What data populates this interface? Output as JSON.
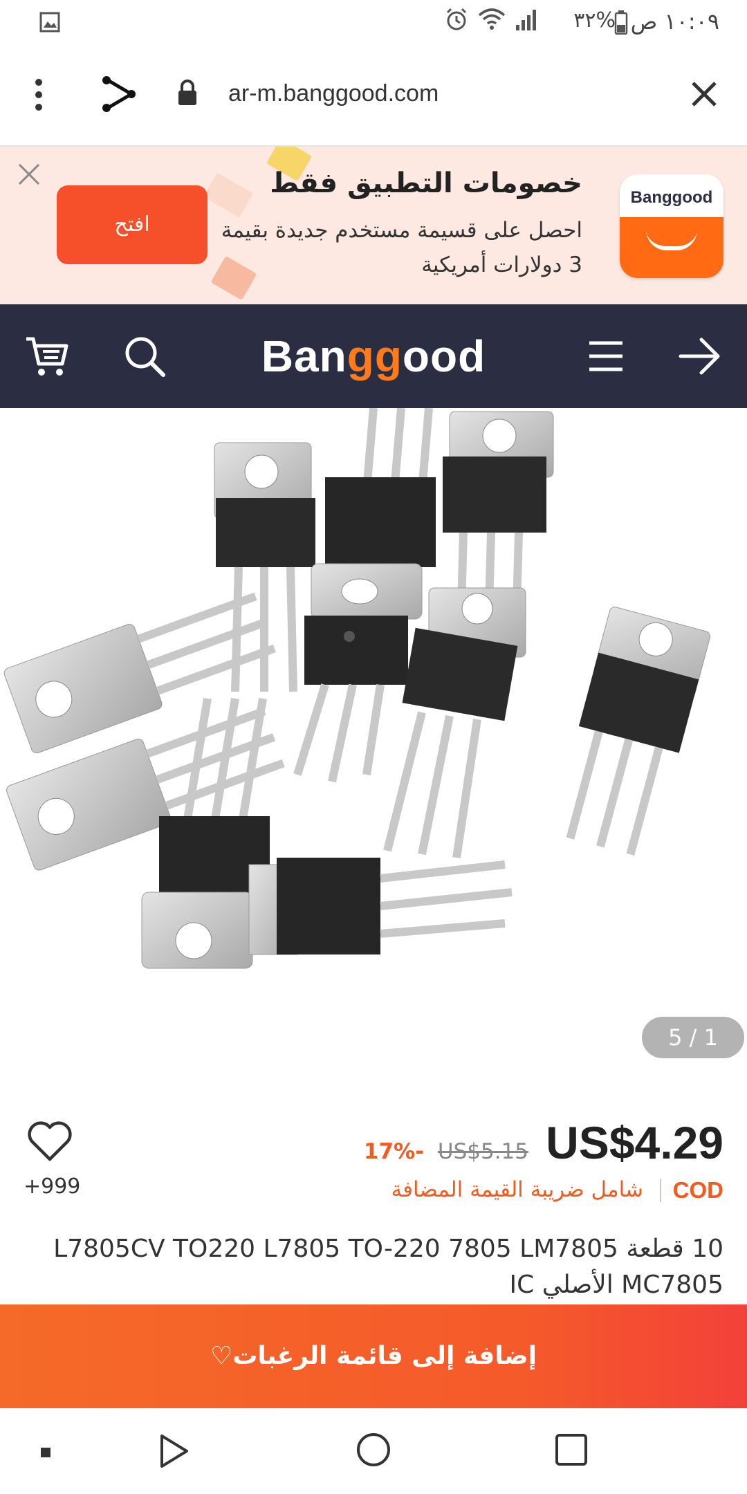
{
  "status_bar": {
    "time": "١٠:٠٩ ص",
    "battery": "٣٢%"
  },
  "browser": {
    "url": "ar-m.banggood.com"
  },
  "app_banner": {
    "title": "خصومات التطبيق فقط",
    "text": "احصل على قسيمة مستخدم جديدة بقيمة 3 دولارات أمريكية",
    "open_button": "افتح",
    "app_icon_word": "Banggood"
  },
  "site_header": {
    "logo_part1": "Ban",
    "logo_part2": "gg",
    "logo_part3": "ood"
  },
  "gallery": {
    "counter": "5 / 1"
  },
  "product": {
    "price": "US$4.29",
    "old_price": "US$5.15",
    "discount": "17%-",
    "cod": "COD",
    "vat": "شامل ضريبة القيمة المضافة",
    "wishlist_count": "+999",
    "title": "10 قطعة L7805CV TO220 L7805 TO-220 7805 LM7805 MC7805 الأصلي IC"
  },
  "actions": {
    "add_to_wishlist": "إضافة إلى قائمة الرغبات♡"
  },
  "colors": {
    "accent": "#f5502a",
    "header_bg": "#2b2d42",
    "banner_bg": "#fde9e1"
  }
}
